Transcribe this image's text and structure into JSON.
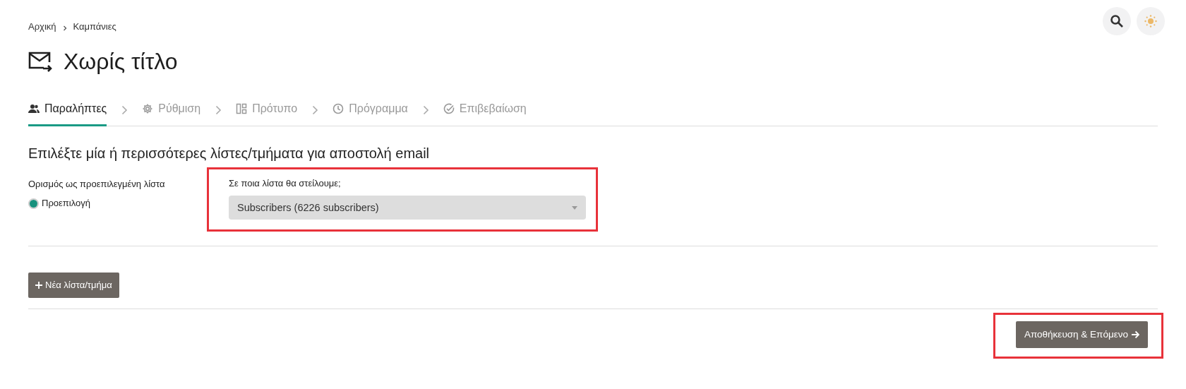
{
  "breadcrumb": [
    "Αρχική",
    "Καμπάνιες"
  ],
  "title": "Χωρίς τίτλο",
  "steps": [
    {
      "label": "Παραλήπτες",
      "selected": true
    },
    {
      "label": "Ρύθμιση",
      "selected": false
    },
    {
      "label": "Πρότυπο",
      "selected": false
    },
    {
      "label": "Πρόγραμμα",
      "selected": false
    },
    {
      "label": "Επιβεβαίωση",
      "selected": false
    }
  ],
  "heading": "Επιλέξτε μία ή περισσότερες λίστες/τμήματα για αποστολή email",
  "default_list": {
    "label": "Ορισμός ως προεπιλεγμένη λίστα",
    "option": "Προεπιλογή",
    "checked": true
  },
  "list_select": {
    "label": "Σε ποια λίστα θα στείλουμε;",
    "value": "Subscribers (6226 subscribers)",
    "highlighted": true
  },
  "new_list_button": {
    "label": "Νέα λίστα/τμήμα"
  },
  "save_button": {
    "label": "Αποθήκευση & Επόμενο",
    "highlighted": true
  }
}
